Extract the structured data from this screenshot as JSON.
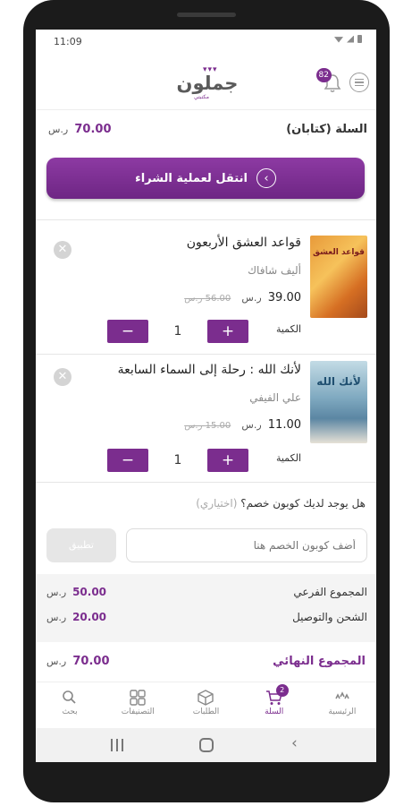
{
  "status_bar": {
    "time": "11:09"
  },
  "header": {
    "logo_text": "جملون",
    "logo_crowns": "▾▾▾",
    "logo_sub": "مكتبتي",
    "notification_count": "82"
  },
  "cart": {
    "title": "السلة (كتابان)",
    "total_price": "70.00",
    "currency": "ر.س",
    "checkout_label": "انتقل لعملية الشراء"
  },
  "items": [
    {
      "title": "قواعد العشق الأربعون",
      "author": "أليف شافاك",
      "price": "39.00",
      "old_price": "56.00 ر.س",
      "qty_label": "الكمية",
      "quantity": "1",
      "cover_text": "قواعد العشق"
    },
    {
      "title": "لأنك الله : رحلة إلى السماء السابعة",
      "author": "علي الفيفي",
      "price": "11.00",
      "old_price": "15.00 ر.س",
      "qty_label": "الكمية",
      "quantity": "1",
      "cover_text": "لأنك الله"
    }
  ],
  "coupon": {
    "question": "هل يوجد لديك كوبون خصم؟",
    "optional": "(اختياري)",
    "placeholder": "أضف كوبون الخصم هنا",
    "apply_label": "تطبيق"
  },
  "totals": {
    "subtotal_label": "المجموع الفرعي",
    "subtotal_value": "50.00",
    "shipping_label": "الشحن والتوصيل",
    "shipping_value": "20.00",
    "grand_label": "المجموع النهائي",
    "grand_value": "70.00"
  },
  "bottom_nav": {
    "home": "الرئيسية",
    "cart": "السلة",
    "cart_badge": "2",
    "orders": "الطلبات",
    "categories": "التصنيفات",
    "search": "بحث"
  },
  "colors": {
    "accent": "#7b2d8e"
  }
}
